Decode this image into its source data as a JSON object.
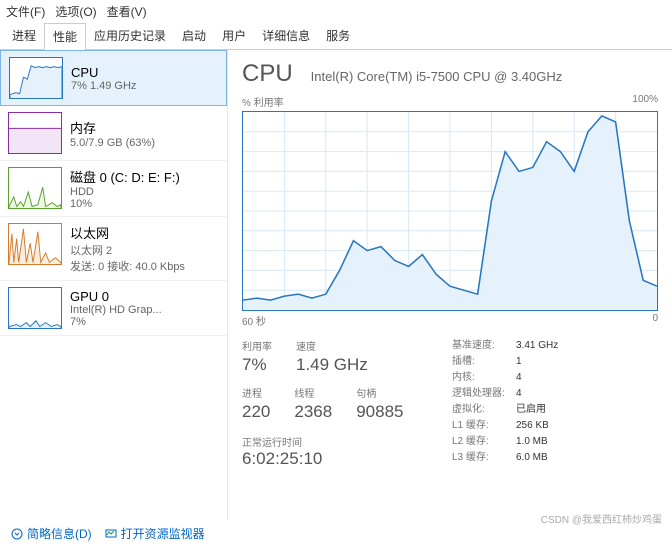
{
  "menu": {
    "file": "文件(F)",
    "options": "选项(O)",
    "view": "查看(V)"
  },
  "tabs": [
    "进程",
    "性能",
    "应用历史记录",
    "启动",
    "用户",
    "详细信息",
    "服务"
  ],
  "active_tab": 1,
  "sidebar": {
    "items": [
      {
        "title": "CPU",
        "sub": "7% 1.49 GHz",
        "color": "#2776c4",
        "fill": "#e5f1fb"
      },
      {
        "title": "内存",
        "sub": "5.0/7.9 GB (63%)",
        "color": "#8a2da5",
        "fill": "#f2e5f7"
      },
      {
        "title": "磁盘 0 (C: D: E: F:)",
        "sub": "HDD",
        "sub2": "10%",
        "color": "#5aa02c",
        "fill": "#edf7e5"
      },
      {
        "title": "以太网",
        "sub": "以太网 2",
        "sub2": "发送: 0 接收: 40.0 Kbps",
        "color": "#d47a2a",
        "fill": "#faeee0"
      },
      {
        "title": "GPU 0",
        "sub": "Intel(R) HD Grap...",
        "sub2": "7%",
        "color": "#2776c4",
        "fill": "#e5f1fb"
      }
    ]
  },
  "content": {
    "title": "CPU",
    "model": "Intel(R) Core(TM) i5-7500 CPU @ 3.40GHz",
    "ylabel": "% 利用率",
    "ymax": "100%",
    "xlabel_left": "60 秒",
    "xlabel_right": "0",
    "stats1": {
      "util_label": "利用率",
      "util": "7%",
      "speed_label": "速度",
      "speed": "1.49 GHz"
    },
    "stats2": {
      "proc_label": "进程",
      "proc": "220",
      "threads_label": "线程",
      "threads": "2368",
      "handles_label": "句柄",
      "handles": "90885"
    },
    "uptime_label": "正常运行时间",
    "uptime": "6:02:25:10",
    "details": {
      "base_speed_label": "基准速度:",
      "base_speed": "3.41 GHz",
      "sockets_label": "插槽:",
      "sockets": "1",
      "cores_label": "内核:",
      "cores": "4",
      "lp_label": "逻辑处理器:",
      "lp": "4",
      "virt_label": "虚拟化:",
      "virt": "已启用",
      "l1_label": "L1 缓存:",
      "l1": "256 KB",
      "l2_label": "L2 缓存:",
      "l2": "1.0 MB",
      "l3_label": "L3 缓存:",
      "l3": "6.0 MB"
    }
  },
  "chart_data": {
    "type": "line",
    "title": "% 利用率",
    "xlabel": "60 秒",
    "ylabel": "% 利用率",
    "ylim": [
      0,
      100
    ],
    "x": [
      60,
      58,
      56,
      54,
      52,
      50,
      48,
      46,
      44,
      42,
      40,
      38,
      36,
      34,
      32,
      30,
      28,
      26,
      24,
      22,
      20,
      18,
      16,
      14,
      12,
      10,
      8,
      6,
      4,
      2,
      0
    ],
    "values": [
      5,
      6,
      5,
      7,
      8,
      6,
      8,
      20,
      35,
      30,
      32,
      25,
      22,
      28,
      18,
      12,
      10,
      8,
      55,
      80,
      70,
      72,
      85,
      80,
      70,
      90,
      98,
      95,
      45,
      15,
      12
    ]
  },
  "footer": {
    "brief": "简略信息(D)",
    "resmon": "打开资源监视器"
  },
  "watermark": "CSDN @我爱西红柿炒鸡蛋"
}
